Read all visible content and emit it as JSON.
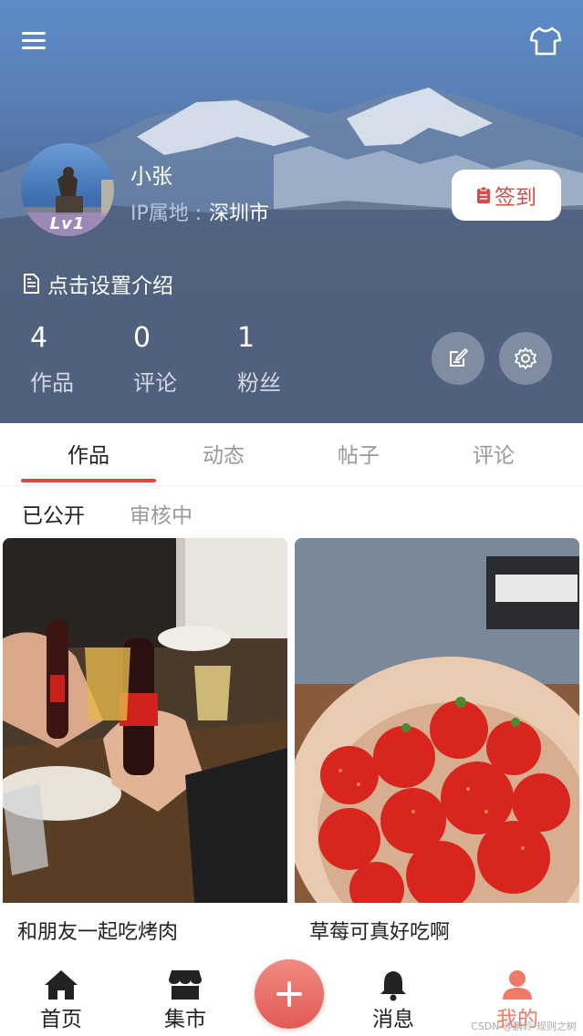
{
  "profile": {
    "avatar_badge": "Lv1",
    "username": "小张",
    "ip_label": "IP属地 :",
    "ip_value": "深圳市",
    "signin_label": "签到",
    "intro_label": "点击设置介绍"
  },
  "stats": [
    {
      "value": "4",
      "label": "作品"
    },
    {
      "value": "0",
      "label": "评论"
    },
    {
      "value": "1",
      "label": "粉丝"
    }
  ],
  "tabs": [
    {
      "label": "作品",
      "active": true
    },
    {
      "label": "动态",
      "active": false
    },
    {
      "label": "帖子",
      "active": false
    },
    {
      "label": "评论",
      "active": false
    }
  ],
  "sub_tabs": [
    {
      "label": "已公开",
      "active": true
    },
    {
      "label": "审核中",
      "active": false
    }
  ],
  "posts": [
    {
      "title": "和朋友一起吃烤肉",
      "image": "friends-toasting-cola-photo"
    },
    {
      "title": "草莓可真好吃啊",
      "image": "bowl-of-strawberries-photo"
    }
  ],
  "nav": [
    {
      "label": "首页",
      "icon": "home-icon"
    },
    {
      "label": "集市",
      "icon": "store-icon"
    },
    {
      "label": "消息",
      "icon": "bell-icon"
    },
    {
      "label": "我的",
      "icon": "user-icon",
      "active": true
    }
  ],
  "icons": [
    "menu-icon",
    "shirt-icon",
    "clipboard-icon",
    "document-icon",
    "edit-icon",
    "gear-icon",
    "plus-icon"
  ],
  "colors": {
    "accent": "#e0483c",
    "nav_active": "#f07a6a",
    "fab": "#e8625c"
  },
  "watermark": "CSDN @鹏岭-规则之树"
}
